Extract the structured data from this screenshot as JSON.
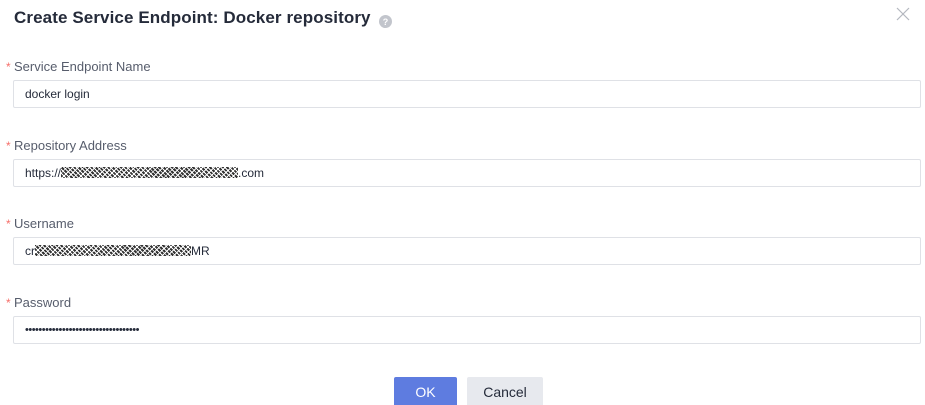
{
  "dialog": {
    "title": "Create Service Endpoint: Docker repository",
    "help_icon": "question-circle-icon",
    "close_icon": "close-x-icon"
  },
  "fields": {
    "endpoint_name": {
      "label": "Service Endpoint Name",
      "required_mark": "*",
      "value": "docker login"
    },
    "repository_address": {
      "label": "Repository Address",
      "required_mark": "*",
      "value_prefix": "https://",
      "value_suffix": ".com"
    },
    "username": {
      "label": "Username",
      "required_mark": "*",
      "value_prefix": "cr",
      "value_suffix": "MR"
    },
    "password": {
      "label": "Password",
      "required_mark": "*",
      "masked_value": "••••••••••••••••••••••••••••••••••"
    }
  },
  "buttons": {
    "ok_label": "OK",
    "cancel_label": "Cancel"
  },
  "colors": {
    "primary": "#5e7ce0",
    "required": "#f66f6a",
    "border": "#dfe1e6",
    "cancel_bg": "#e7e9ee"
  }
}
